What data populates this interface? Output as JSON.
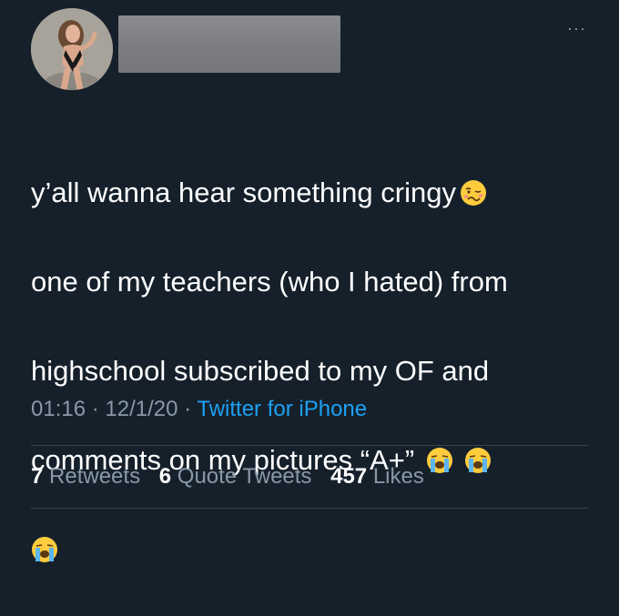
{
  "header": {
    "more_icon": "more-horizontal-icon",
    "more_label": "···"
  },
  "tweet": {
    "line1": "y’all wanna hear something cringy",
    "line2": "one of my teachers (who I hated) from",
    "line3": "highschool subscribed to my OF and",
    "line4": "comments on my pictures “A+”",
    "emojis": [
      "woozy-face-emoji",
      "loudly-crying-face-emoji",
      "loudly-crying-face-emoji",
      "loudly-crying-face-emoji"
    ]
  },
  "meta": {
    "time": "01:16",
    "sep1": " · ",
    "date": "12/1/20",
    "sep2": " · ",
    "source": "Twitter for iPhone"
  },
  "stats": {
    "retweets_count": "7",
    "retweets_label": "Retweets",
    "quote_count": "6",
    "quote_label": "Quote Tweets",
    "likes_count": "457",
    "likes_label": "Likes"
  },
  "colors": {
    "background": "#15202b",
    "text": "#ffffff",
    "secondary": "#8899a6",
    "link": "#1da1f2",
    "divider": "#38444d"
  }
}
